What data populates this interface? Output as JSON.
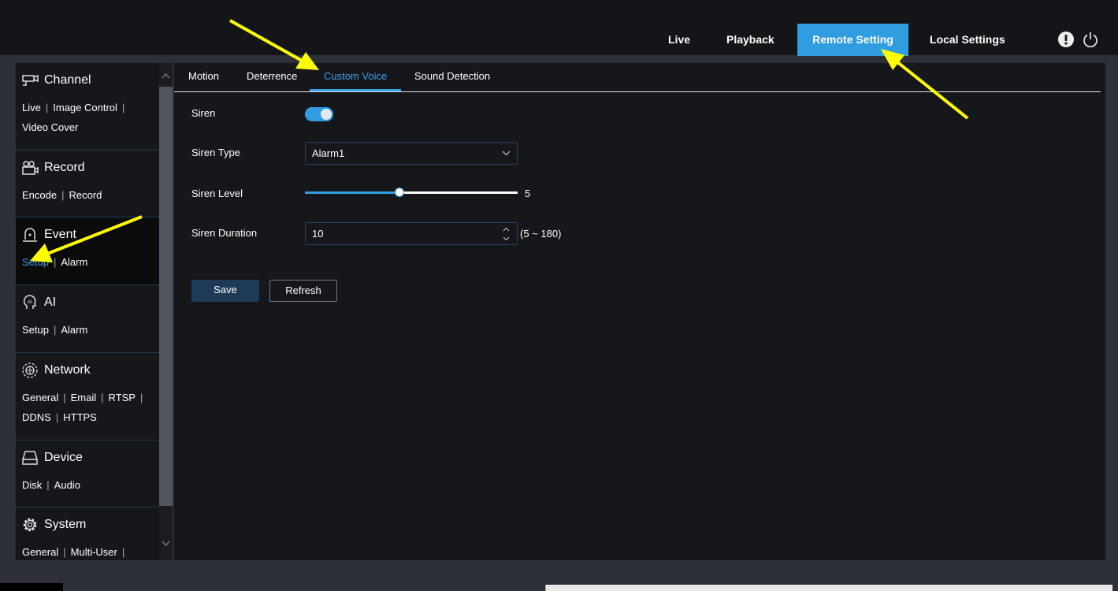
{
  "topnav": {
    "items": [
      "Live",
      "Playback",
      "Remote Setting",
      "Local Settings"
    ],
    "active": "Remote Setting"
  },
  "icons": {
    "info": "info-icon",
    "power": "power-icon"
  },
  "sidebar": {
    "sections": [
      {
        "title": "Channel",
        "icon": "camera-icon",
        "links": [
          "Live",
          "Image Control",
          "Video Cover"
        ]
      },
      {
        "title": "Record",
        "icon": "video-camera-icon",
        "links": [
          "Encode",
          "Record"
        ]
      },
      {
        "title": "Event",
        "icon": "siren-icon",
        "links": [
          "Setup",
          "Alarm"
        ],
        "selected": "Setup"
      },
      {
        "title": "AI",
        "icon": "ai-head-icon",
        "links": [
          "Setup",
          "Alarm"
        ]
      },
      {
        "title": "Network",
        "icon": "globe-icon",
        "links": [
          "General",
          "Email",
          "RTSP",
          "DDNS",
          "HTTPS"
        ]
      },
      {
        "title": "Device",
        "icon": "nvr-device-icon",
        "links": [
          "Disk",
          "Audio"
        ]
      },
      {
        "title": "System",
        "icon": "gear-icon",
        "links": [
          "General",
          "Multi-User"
        ]
      }
    ]
  },
  "tabs": [
    "Motion",
    "Deterrence",
    "Custom Voice",
    "Sound Detection"
  ],
  "active_tab": "Custom Voice",
  "form": {
    "siren_label": "Siren",
    "siren_on": true,
    "siren_type_label": "Siren Type",
    "siren_type_value": "Alarm1",
    "siren_level_label": "Siren Level",
    "siren_level_value": "5",
    "siren_duration_label": "Siren Duration",
    "siren_duration_value": "10",
    "siren_duration_range": "(5 ~ 180)"
  },
  "buttons": {
    "save": "Save",
    "refresh": "Refresh"
  },
  "colors": {
    "accent": "#2f9de0",
    "annotation_arrow": "#ffff00",
    "background": "#16171b"
  }
}
